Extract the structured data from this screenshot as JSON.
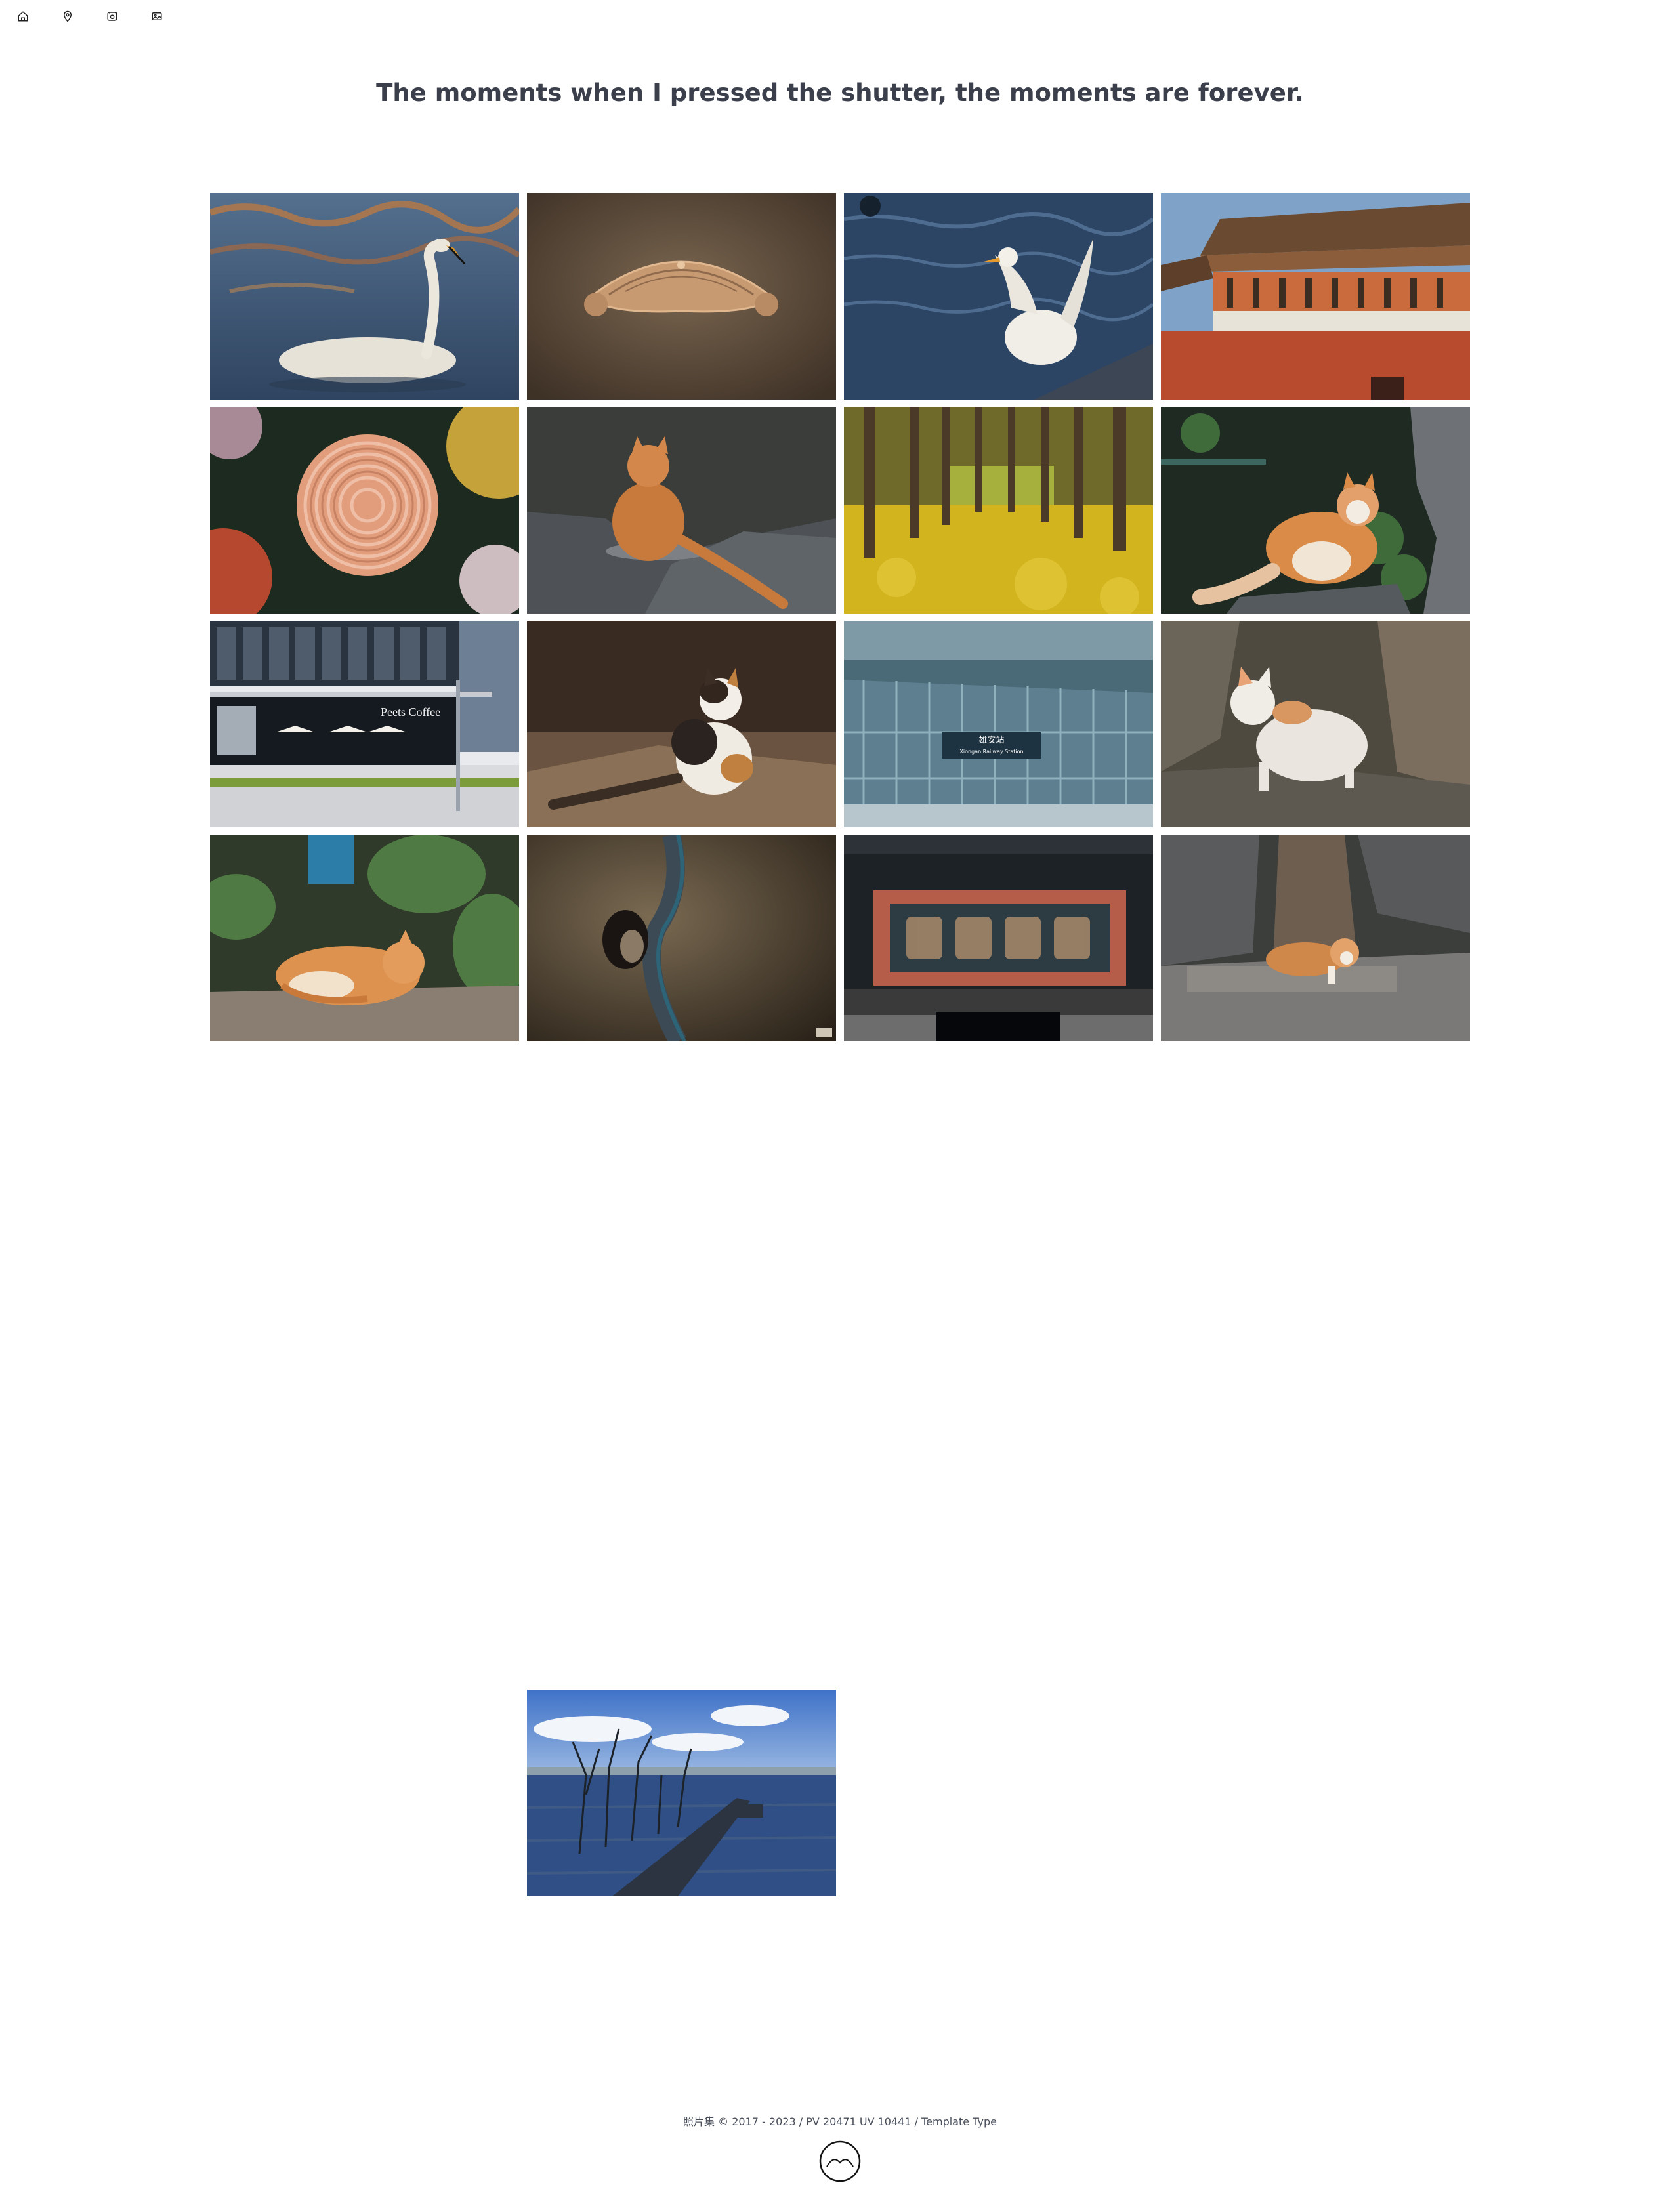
{
  "nav": {
    "items": [
      {
        "icon": "home-icon"
      },
      {
        "icon": "map-pin-icon"
      },
      {
        "icon": "camera-icon"
      },
      {
        "icon": "image-icon"
      }
    ]
  },
  "headline": "The moments when I pressed the shutter, the moments are forever.",
  "gallery": {
    "photos": [
      {
        "subject": "swan"
      },
      {
        "subject": "carved-ornament"
      },
      {
        "subject": "duck"
      },
      {
        "subject": "palace"
      },
      {
        "subject": "chrysanthemum"
      },
      {
        "subject": "cat"
      },
      {
        "subject": "ginkgo-forest"
      },
      {
        "subject": "cat"
      },
      {
        "subject": "coffee-shop"
      },
      {
        "subject": "cat"
      },
      {
        "subject": "station"
      },
      {
        "subject": "cat"
      },
      {
        "subject": "cat"
      },
      {
        "subject": "abstract"
      },
      {
        "subject": "plaque"
      },
      {
        "subject": "cat"
      }
    ],
    "extra": {
      "subject": "pier"
    },
    "photo_texts": {
      "storefront_sign": "Peets Coffee",
      "station_sign_cn": "雄安站",
      "station_sign_en": "Xiongan Railway Station"
    }
  },
  "footer": {
    "brand": "照片集",
    "copyright": "© 2017 - 2023",
    "sep1": "/",
    "stats": "PV 20471 UV 10441",
    "sep2": "/",
    "template_link": "Template Type"
  },
  "colors": {
    "text": "#3a3f4b",
    "background": "#ffffff"
  }
}
